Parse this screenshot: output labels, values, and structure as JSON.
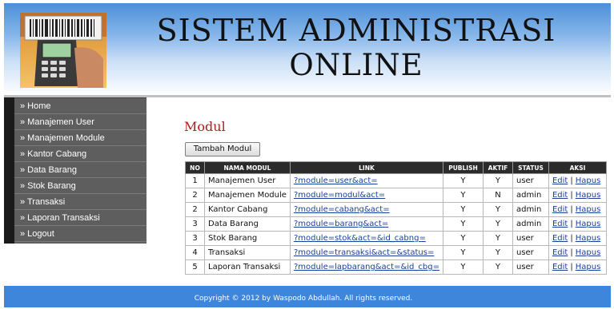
{
  "header": {
    "title_line1": "SISTEM ADMINISTRASI",
    "title_line2": "ONLINE"
  },
  "sidebar": {
    "items": [
      {
        "label": "» Home"
      },
      {
        "label": "» Manajemen User"
      },
      {
        "label": "» Manajemen Module"
      },
      {
        "label": "» Kantor Cabang"
      },
      {
        "label": "» Data Barang"
      },
      {
        "label": "» Stok Barang"
      },
      {
        "label": "» Transaksi"
      },
      {
        "label": "» Laporan Transaksi"
      },
      {
        "label": "» Logout"
      }
    ]
  },
  "main": {
    "page_title": "Modul",
    "add_button": "Tambah Modul",
    "table": {
      "headers": [
        "NO",
        "NAMA MODUL",
        "LINK",
        "PUBLISH",
        "AKTIF",
        "STATUS",
        "AKSI"
      ],
      "rows": [
        {
          "no": "1",
          "nama": "Manajemen User",
          "link": "?module=user&act=",
          "publish": "Y",
          "aktif": "Y",
          "status": "user"
        },
        {
          "no": "2",
          "nama": "Manajemen Module",
          "link": "?module=modul&act=",
          "publish": "Y",
          "aktif": "N",
          "status": "admin"
        },
        {
          "no": "2",
          "nama": "Kantor Cabang",
          "link": "?module=cabang&act=",
          "publish": "Y",
          "aktif": "Y",
          "status": "admin"
        },
        {
          "no": "3",
          "nama": "Data Barang",
          "link": "?module=barang&act=",
          "publish": "Y",
          "aktif": "Y",
          "status": "admin"
        },
        {
          "no": "3",
          "nama": "Stok Barang",
          "link": "?module=stok&act=&id_cabng=",
          "publish": "Y",
          "aktif": "Y",
          "status": "user"
        },
        {
          "no": "4",
          "nama": "Transaksi",
          "link": "?module=transaksi&act=&status=",
          "publish": "Y",
          "aktif": "Y",
          "status": "user"
        },
        {
          "no": "5",
          "nama": "Laporan Transaksi",
          "link": "?module=lapbarang&act=&id_cbg=",
          "publish": "Y",
          "aktif": "Y",
          "status": "user"
        }
      ],
      "edit_label": "Edit",
      "delete_label": "Hapus",
      "action_separator": "|"
    }
  },
  "footer": {
    "copyright": "Copyright © 2012 by Waspodo Abdullah. All rights reserved."
  },
  "colors": {
    "header_gradient_top": "#4d8fd8",
    "sidebar_bg": "#5e5e5e",
    "table_header_bg": "#2b2b2b",
    "page_title": "#b11b1b",
    "link": "#1a3f9c",
    "footer_bg": "#3d86dc"
  },
  "icons": {
    "logo": "barcode-scanner-icon"
  }
}
